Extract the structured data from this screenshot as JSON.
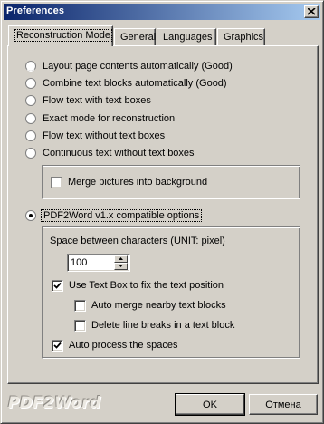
{
  "window": {
    "title": "Preferences"
  },
  "tabs": [
    {
      "label": "Reconstruction Mode",
      "active": true
    },
    {
      "label": "General",
      "active": false
    },
    {
      "label": "Languages",
      "active": false
    },
    {
      "label": "Graphics",
      "active": false
    }
  ],
  "modes": [
    {
      "label": "Layout page contents automatically (Good)",
      "checked": false
    },
    {
      "label": "Combine text blocks automatically (Good)",
      "checked": false
    },
    {
      "label": "Flow text with text boxes",
      "checked": false
    },
    {
      "label": "Exact mode for reconstruction",
      "checked": false
    },
    {
      "label": "Flow text without text boxes",
      "checked": false
    },
    {
      "label": "Continuous text without text boxes",
      "checked": false
    }
  ],
  "merge_pictures": {
    "label": "Merge pictures into background",
    "checked": false
  },
  "pdf2word_option": {
    "label": "PDF2Word v1.x compatible options",
    "checked": true
  },
  "compat": {
    "spacing_label": "Space between characters (UNIT: pixel)",
    "spacing_value": "100",
    "use_textbox": {
      "label": "Use Text Box to fix the text position",
      "checked": true
    },
    "auto_merge": {
      "label": "Auto merge nearby text blocks",
      "checked": false
    },
    "delete_breaks": {
      "label": "Delete line breaks in a text block",
      "checked": false
    },
    "auto_spaces": {
      "label": "Auto process the spaces",
      "checked": true
    }
  },
  "footer": {
    "brand": "PDF2Word",
    "ok_label": "OK",
    "cancel_label": "Отмена"
  }
}
